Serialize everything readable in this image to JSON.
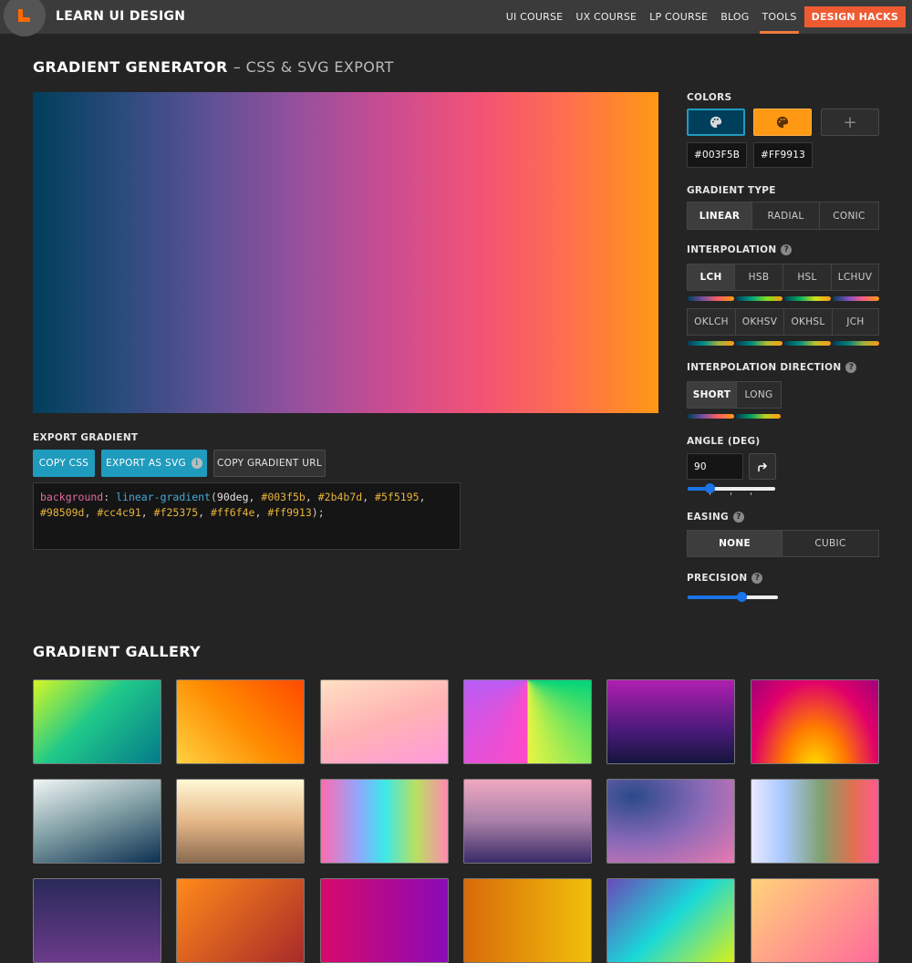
{
  "header": {
    "brand": "LEARN UI DESIGN",
    "nav": [
      {
        "label": "UI COURSE"
      },
      {
        "label": "UX COURSE"
      },
      {
        "label": "LP COURSE"
      },
      {
        "label": "BLOG"
      },
      {
        "label": "TOOLS",
        "active": true
      },
      {
        "label": "DESIGN HACKS"
      }
    ],
    "accent": "#ee5b33"
  },
  "page": {
    "title": "GRADIENT GENERATOR",
    "subtitle": "– CSS & SVG EXPORT"
  },
  "preview": {
    "stops": [
      "#003f5b",
      "#2b4b7d",
      "#5f5195",
      "#98509d",
      "#cc4c91",
      "#f25375",
      "#ff6f4e",
      "#ff9913"
    ]
  },
  "export": {
    "label": "EXPORT GRADIENT",
    "copy_css": "COPY CSS",
    "export_svg": "EXPORT AS SVG",
    "copy_url": "COPY GRADIENT URL",
    "code_prop": "background",
    "code_fn": "linear-gradient",
    "code_angle": "90deg",
    "code_hexes": [
      "#003f5b",
      "#2b4b7d",
      "#5f5195",
      "#98509d",
      "#cc4c91",
      "#f25375",
      "#ff6f4e",
      "#ff9913"
    ]
  },
  "controls": {
    "colors_label": "COLORS",
    "color1": "#003F5B",
    "color2": "#FF9913",
    "add_icon": "plus-icon",
    "gradient_type_label": "GRADIENT TYPE",
    "gradient_types": [
      "LINEAR",
      "RADIAL",
      "CONIC"
    ],
    "gradient_type_selected": "LINEAR",
    "interpolation_label": "INTERPOLATION",
    "interpolation_row1": [
      "LCH",
      "HSB",
      "HSL",
      "LCHUV"
    ],
    "interpolation_row2": [
      "OKLCH",
      "OKHSV",
      "OKHSL",
      "JCH"
    ],
    "interpolation_selected": "LCH",
    "direction_label": "INTERPOLATION DIRECTION",
    "directions": [
      "SHORT",
      "LONG"
    ],
    "direction_selected": "SHORT",
    "angle_label": "ANGLE (DEG)",
    "angle_value": "90",
    "angle_slider_fraction": 0.25,
    "easing_label": "EASING",
    "easings": [
      "NONE",
      "CUBIC"
    ],
    "easing_selected": "NONE",
    "precision_label": "PRECISION",
    "precision_fraction": 0.6
  },
  "gallery": {
    "title": "GRADIENT GALLERY",
    "tiles": [
      "linear-gradient(135deg,#d4f724,#1fc98a 45%,#057a8a)",
      "linear-gradient(45deg,#ffd23f,#ff8a00 50%,#ff4a00)",
      "linear-gradient(160deg,#ffe0c4,#ffb3b3 50%,#ff9adc)",
      "conic-gradient(from 180deg at 50% 0%,#ff4ac8,#b85cf5,#00a8ff,#00d47a,#e6f542)",
      "linear-gradient(180deg,#b01eb0,#4a1a7a 60%,#15153d)",
      "radial-gradient(ellipse at 50% 110%,#ffe600,#ff7a00 35%,#e0006a 70%,#a0007a)",
      "linear-gradient(160deg,#f0f5f5,#7a9aa0 50%,#0e2f52)",
      "linear-gradient(180deg,#fff8d6,#e6b888 50%,#8a6a50)",
      "linear-gradient(90deg,#ff6bb0,#8fa8ff 30%,#3ce8e8 50%,#b8e060 75%,#ff8ab0)",
      "linear-gradient(180deg,#f0a8c0,#a880a8 50%,#3a2a68)",
      "radial-gradient(ellipse at 20% 20%,#2a4a8a,#8c6ab8 50%,#e87ab0)",
      "linear-gradient(90deg,#e8e8ff,#a8c8ff 25%,#80a070 55%,#e07050 80%,#ff5a90)",
      "linear-gradient(180deg,#2a2a5a,#6a3a8a)",
      "linear-gradient(135deg,#ff8a1a,#a82a2a)",
      "linear-gradient(90deg,#d80a6a,#8a0ab8)",
      "linear-gradient(90deg,#d86a0a,#f0c00a)",
      "linear-gradient(135deg,#6a4ab8,#1ad8d8 50%,#d8f01a)",
      "linear-gradient(135deg,#ffd27a,#ff6a9a)"
    ]
  }
}
